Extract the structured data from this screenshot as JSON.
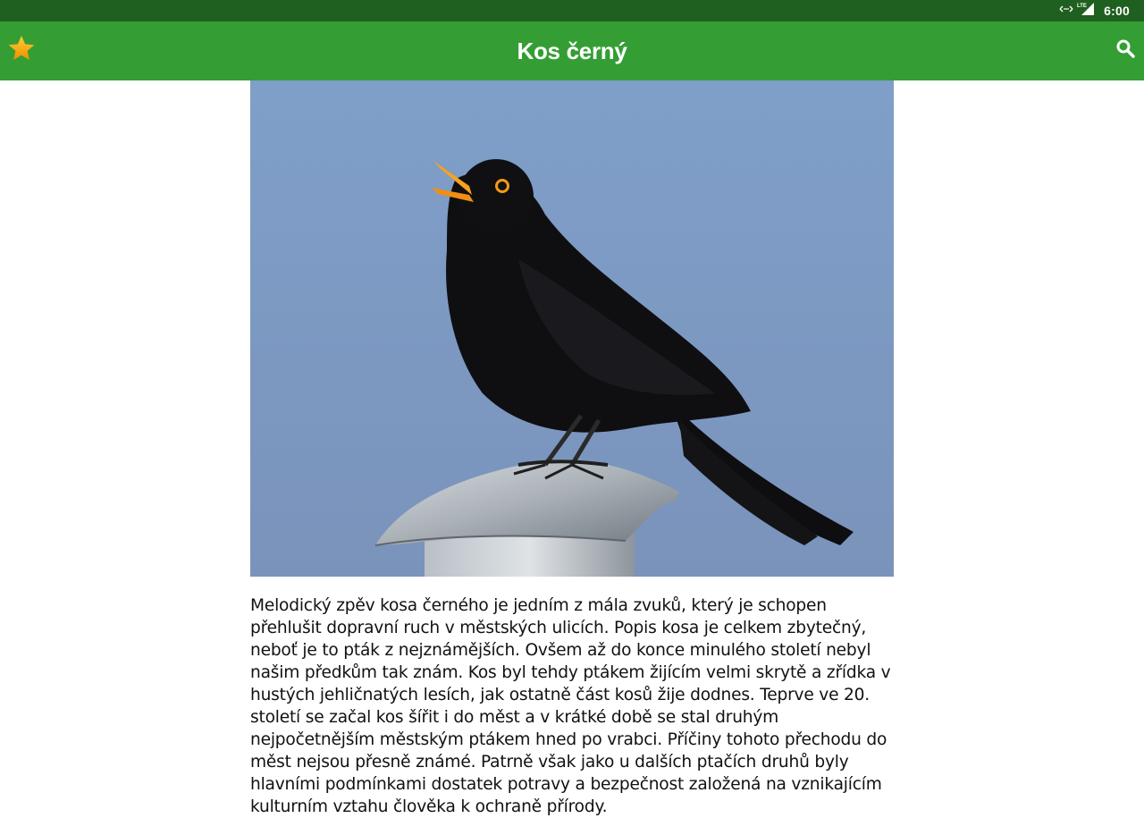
{
  "status_bar": {
    "time": "6:00",
    "network": "LTE",
    "icons": [
      "data-sync-icon",
      "signal-icon"
    ]
  },
  "app_bar": {
    "title": "Kos černý",
    "favorite_icon": "star-icon",
    "search_icon": "search-icon"
  },
  "colors": {
    "status_bar": "#1f5f1f",
    "app_bar": "#349e34",
    "star": "#f5a623",
    "text": "#111111"
  },
  "article": {
    "image_subject": "blackbird-photo",
    "body": "Melodický zpěv kosa černého je jedním z mála zvuků, který je schopen přehlušit dopravní ruch v městských ulicích. Popis kosa je celkem zbytečný, neboť je to pták z nejznámějších. Ovšem až do konce minulého století nebyl našim předkům tak znám. Kos byl tehdy ptákem žijícím velmi skrytě a zřídka v hustých jehličnatých lesích, jak ostatně část kosů žije dodnes. Teprve ve 20. století se začal kos šířit i do měst a v krátké době se stal druhým nejpočetnějším městským ptákem hned po vrabci. Příčiny tohoto přechodu do měst nejsou přesně známé. Patrně však jako u dalších ptačích druhů byly hlavními podmínkami dostatek potravy a bezpečnost založená na vznikajícím kulturním vztahu člověka k ochraně přírody."
  }
}
